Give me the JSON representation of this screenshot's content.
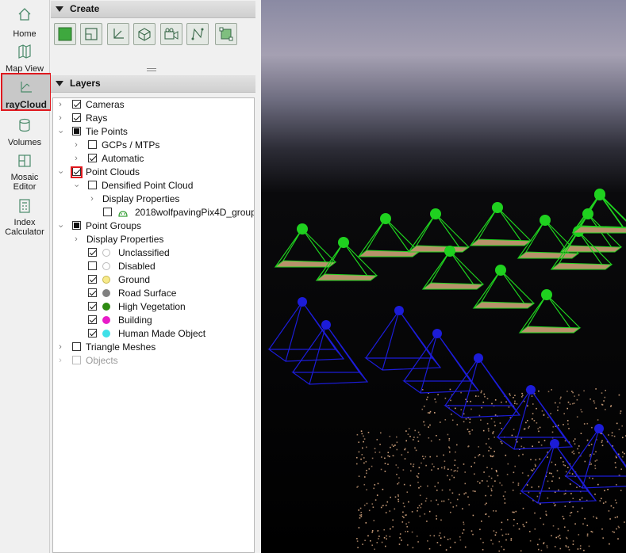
{
  "nav": {
    "items": [
      {
        "label": "Home",
        "icon": "home-icon"
      },
      {
        "label": "Map View",
        "icon": "map-icon"
      },
      {
        "label": "rayCloud",
        "icon": "raycloud-icon",
        "active": true
      },
      {
        "label": "Volumes",
        "icon": "volumes-icon"
      },
      {
        "label": "Mosaic Editor",
        "icon": "mosaic-icon"
      },
      {
        "label": "Index Calculator",
        "icon": "index-calculator-icon"
      }
    ]
  },
  "create": {
    "title": "Create",
    "tools": [
      "new-point-cloud-icon",
      "new-surface-icon",
      "new-axes-icon",
      "new-volume-icon",
      "new-video-camera-icon",
      "new-polyline-icon",
      "new-clip-box-icon"
    ]
  },
  "layers": {
    "title": "Layers",
    "items": {
      "cameras": "Cameras",
      "rays": "Rays",
      "tie_points": "Tie Points",
      "gcps": "GCPs / MTPs",
      "automatic": "Automatic",
      "point_clouds": "Point Clouds",
      "densified": "Densified Point Cloud",
      "display_properties_1": "Display Properties",
      "group": "2018wolfpavingPix4D_group",
      "point_groups": "Point Groups",
      "display_properties_2": "Display Properties",
      "unclassified": "Unclassified",
      "disabled": "Disabled",
      "ground": "Ground",
      "road_surface": "Road Surface",
      "high_vegetation": "High Vegetation",
      "building": "Building",
      "human_made": "Human Made Object",
      "triangle_meshes": "Triangle Meshes",
      "objects": "Objects"
    },
    "class_colors": {
      "unclassified": "#ffffff",
      "disabled": "#ffffff",
      "ground": "#f7ea8a",
      "road_surface": "#808080",
      "high_vegetation": "#2e8b12",
      "building": "#e81cc8",
      "human_made": "#3fe0e8"
    }
  },
  "colors": {
    "highlight": "#e0181e",
    "camera_green": "#1fd11f",
    "camera_blue": "#1c1cd8"
  }
}
